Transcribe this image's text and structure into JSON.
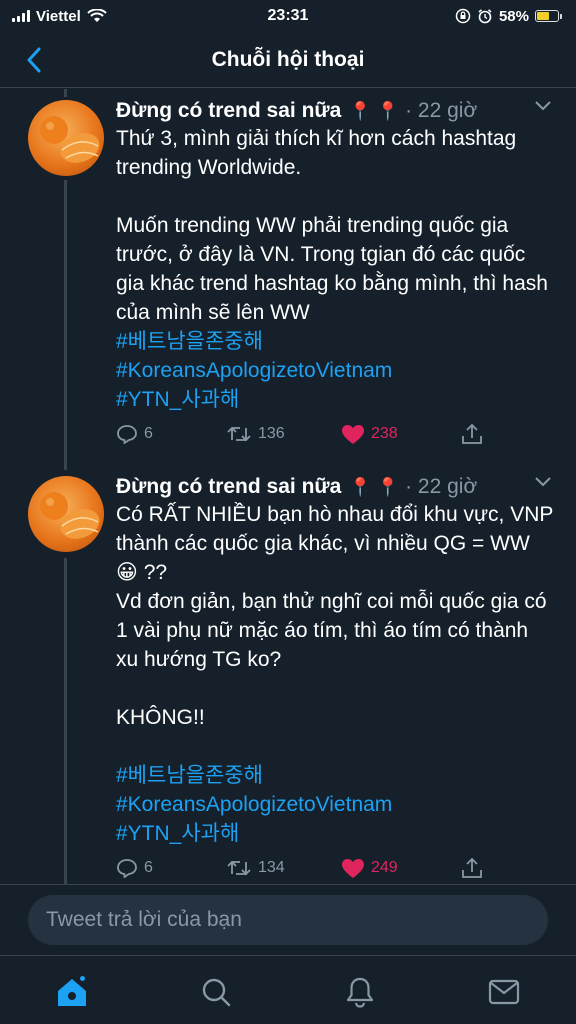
{
  "status_bar": {
    "carrier": "Viettel",
    "time": "23:31",
    "battery_percent": "58%",
    "battery_level": 0.58
  },
  "nav": {
    "title": "Chuỗi hội thoại",
    "back_icon": "chevron-left-icon"
  },
  "tweets": [
    {
      "author": "Đừng có trend sai nữa",
      "pins": "📍 📍",
      "time": "· 22 giờ",
      "paragraphs": [
        "Thứ 3, mình giải thích kĩ hơn cách hashtag trending Worldwide.",
        "Muốn trending WW phải trending quốc gia trước, ở đây là VN. Trong tgian đó các quốc gia khác trend hashtag ko bằng mình, thì hash của mình sẽ lên WW"
      ],
      "hashtags": [
        "#베트남을존중해",
        "#KoreansApologizetoVietnam",
        "#YTN_사과해"
      ],
      "replies": "6",
      "retweets": "136",
      "likes": "238"
    },
    {
      "author": "Đừng có trend sai nữa",
      "pins": "📍 📍",
      "time": "· 22 giờ",
      "paragraphs": [
        "Có RẤT NHIỀU bạn hò nhau đổi khu vực, VNP thành các quốc gia khác, vì nhiều QG = WW 😀 ??\nVd đơn giản, bạn thử nghĩ coi mỗi quốc gia có 1 vài phụ nữ mặc áo tím, thì áo tím có thành xu hướng TG ko?",
        "KHÔNG!!"
      ],
      "hashtags": [
        "#베트남을존중해",
        "#KoreansApologizetoVietnam",
        "#YTN_사과해"
      ],
      "replies": "6",
      "retweets": "134",
      "likes": "249"
    }
  ],
  "reply_box": {
    "placeholder": "Tweet trả lời của bạn"
  },
  "tab_bar": {
    "tabs": [
      "home-icon",
      "search-icon",
      "bell-icon",
      "mail-icon"
    ]
  },
  "colors": {
    "background": "#15202b",
    "accent": "#1da1f2",
    "like": "#e0245e",
    "muted": "#8899a6"
  }
}
